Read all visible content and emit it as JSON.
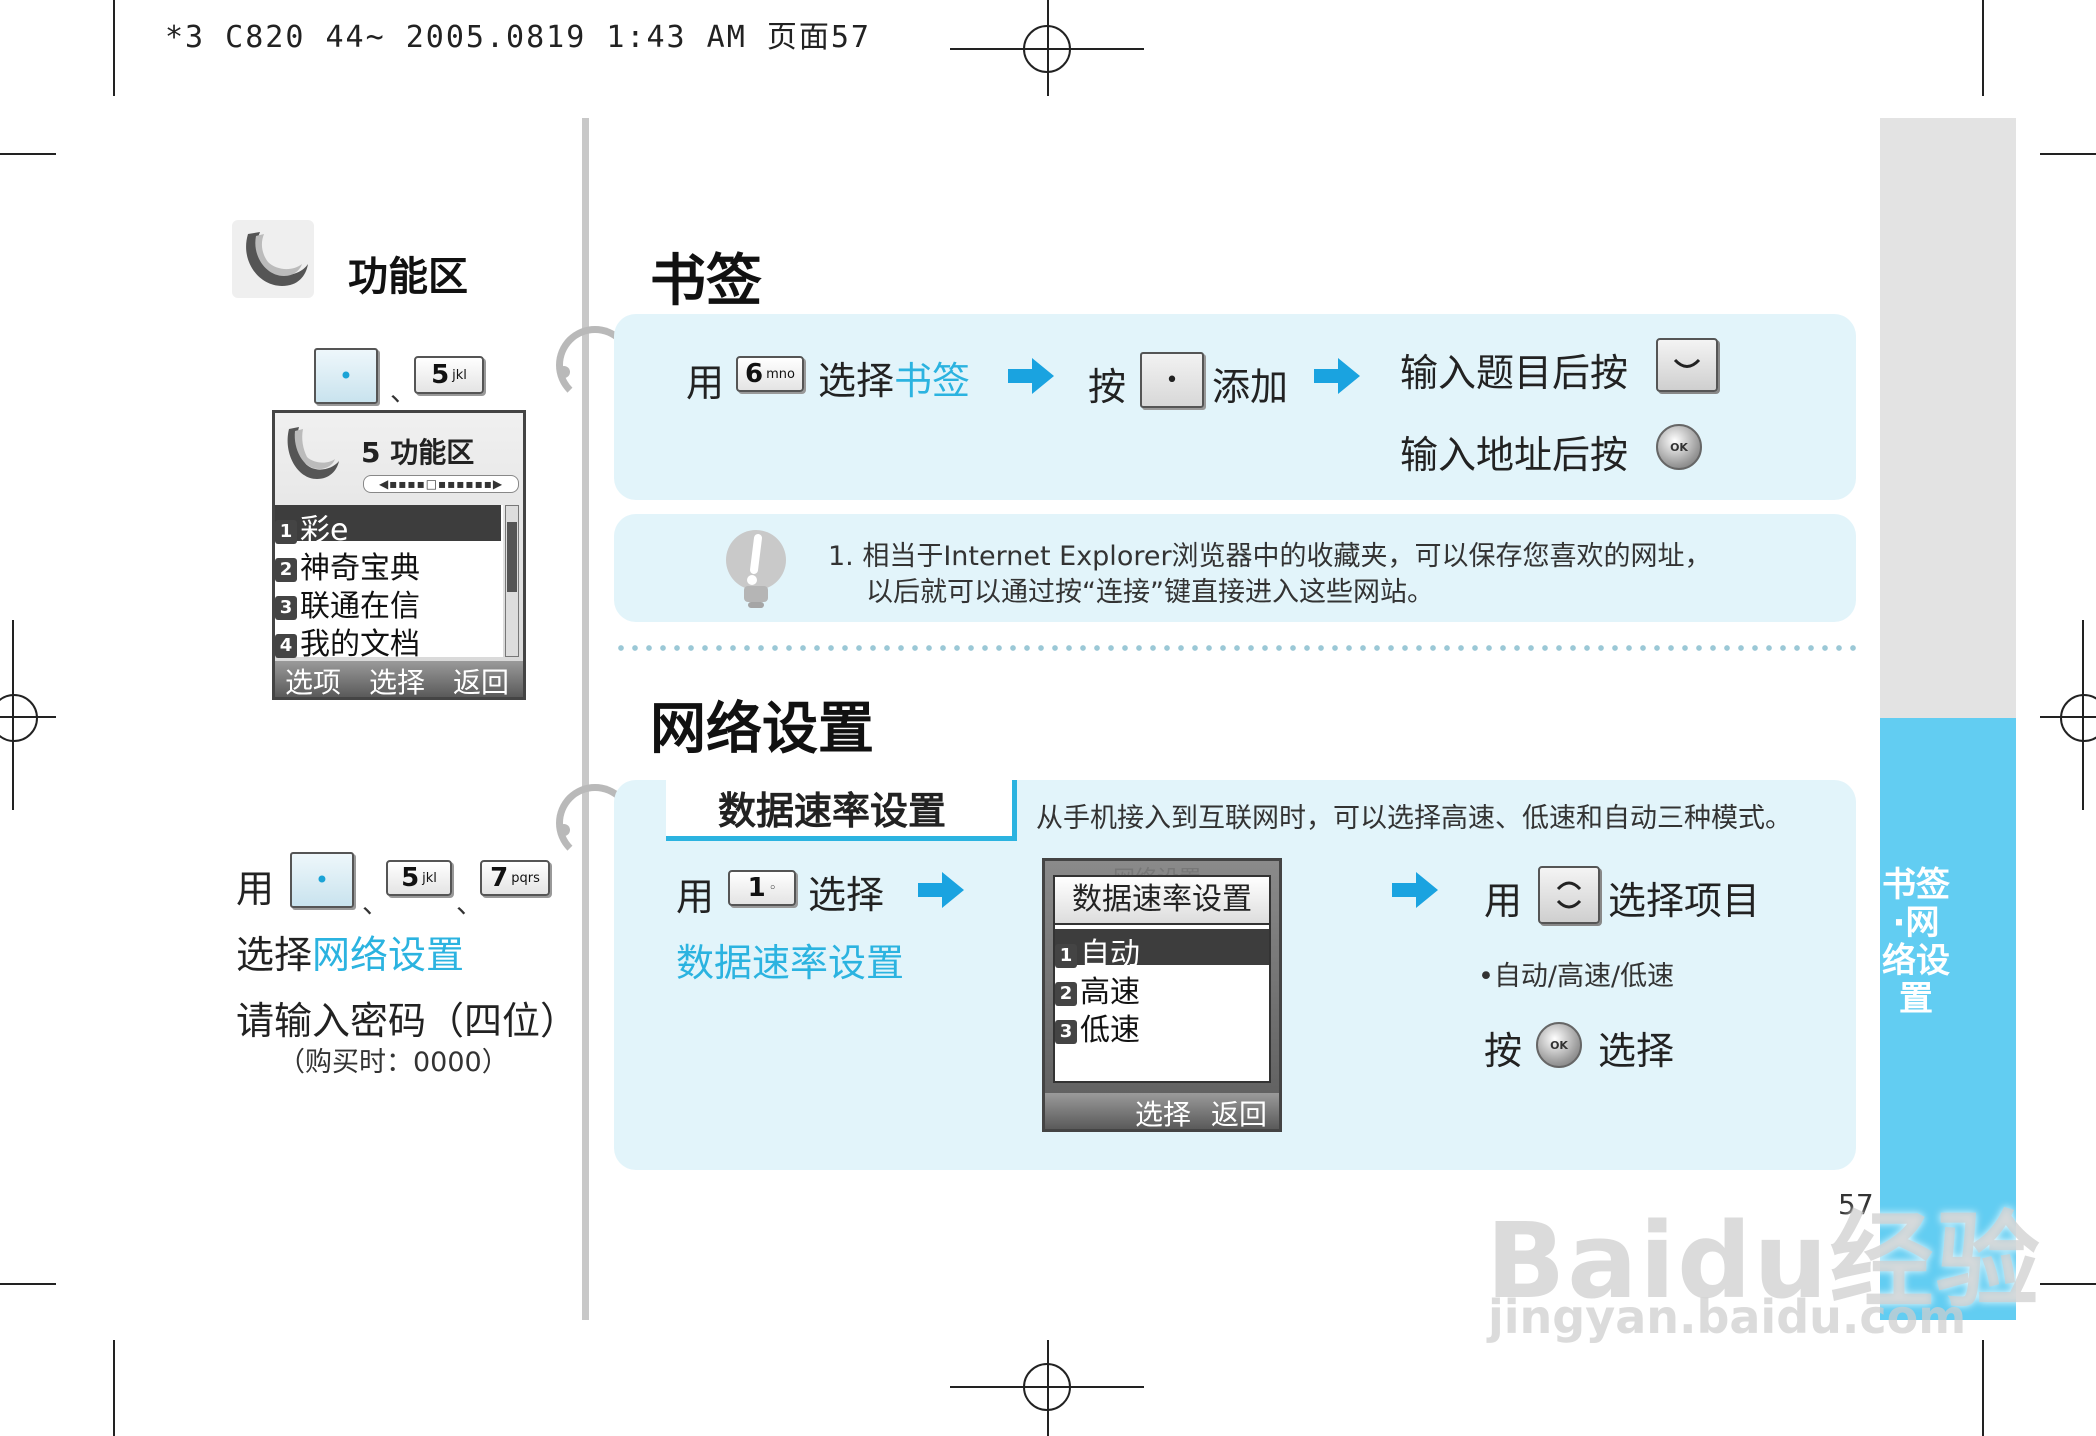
{
  "print_header": "*3 C820 44~ 2005.0819 1:43 AM 页面57",
  "left": {
    "section_title": "功能区",
    "key_sequence_1": {
      "key_2": "5",
      "key_2_letters": "jkl",
      "separator": "、"
    },
    "phone_menu": {
      "title": "5 功能区",
      "items": [
        {
          "num": "1",
          "label": "彩e"
        },
        {
          "num": "2",
          "label": "神奇宝典"
        },
        {
          "num": "3",
          "label": "联通在信"
        },
        {
          "num": "4",
          "label": "我的文档"
        }
      ],
      "softkeys": {
        "left": "选项",
        "center": "选择",
        "right": "返回"
      }
    },
    "instruction": {
      "use_label": "用",
      "key_2": "5",
      "key_2_letters": "jkl",
      "key_3": "7",
      "key_3_letters": "pqrs",
      "separator": "、",
      "select_prefix": "选择",
      "select_target": "网络设置",
      "password_prompt": "请输入密码（四位）",
      "password_note": "（购买时：0000）"
    }
  },
  "bookmark": {
    "title": "书签",
    "use_label": "用",
    "key": "6",
    "key_letters": "mno",
    "select_prefix": "选择",
    "select_target": "书签",
    "press_label": "按",
    "add_label": "添加",
    "after_title_label": "输入题目后按",
    "after_address_label": "输入地址后按",
    "tip_line_1": "1. 相当于Internet Explorer浏览器中的收藏夹，可以保存您喜欢的网址，",
    "tip_line_2": "以后就可以通过按“连接”键直接进入这些网站。"
  },
  "network": {
    "title": "网络设置",
    "subsection_title": "数据速率设置",
    "subsection_desc": "从手机接入到互联网时，可以选择高速、低速和自动三种模式。",
    "use_label": "用",
    "key": "1",
    "select_label": "选择",
    "select_target": "数据速率设置",
    "phone_screen": {
      "ghost_title": "网络设置",
      "title": "数据速率设置",
      "items": [
        {
          "num": "1",
          "label": "自动"
        },
        {
          "num": "2",
          "label": "高速"
        },
        {
          "num": "3",
          "label": "低速"
        }
      ],
      "softkeys": {
        "center": "选择",
        "right": "返回"
      }
    },
    "nav_use_label": "用",
    "nav_select_label": "选择项目",
    "options_bullet": "自动/高速/低速",
    "press_label": "按",
    "press_select_label": "选择"
  },
  "side_tab": {
    "label": "书签·网络设置"
  },
  "page_number": "57",
  "watermark": {
    "main": "Baidu经验",
    "sub": "jingyan.baidu.com"
  },
  "colors": {
    "accent_cyan": "#2bb3e0",
    "panel_bg": "#e2f4fa",
    "side_tab_blue": "#62cdf2",
    "side_tab_gray": "#e3e3e3"
  },
  "icons": [
    "function-zone-icon",
    "center-key-icon",
    "arrow-right-icon",
    "soft-key-down-icon",
    "ok-key-icon",
    "lightbulb-icon",
    "nav-updown-key-icon"
  ]
}
